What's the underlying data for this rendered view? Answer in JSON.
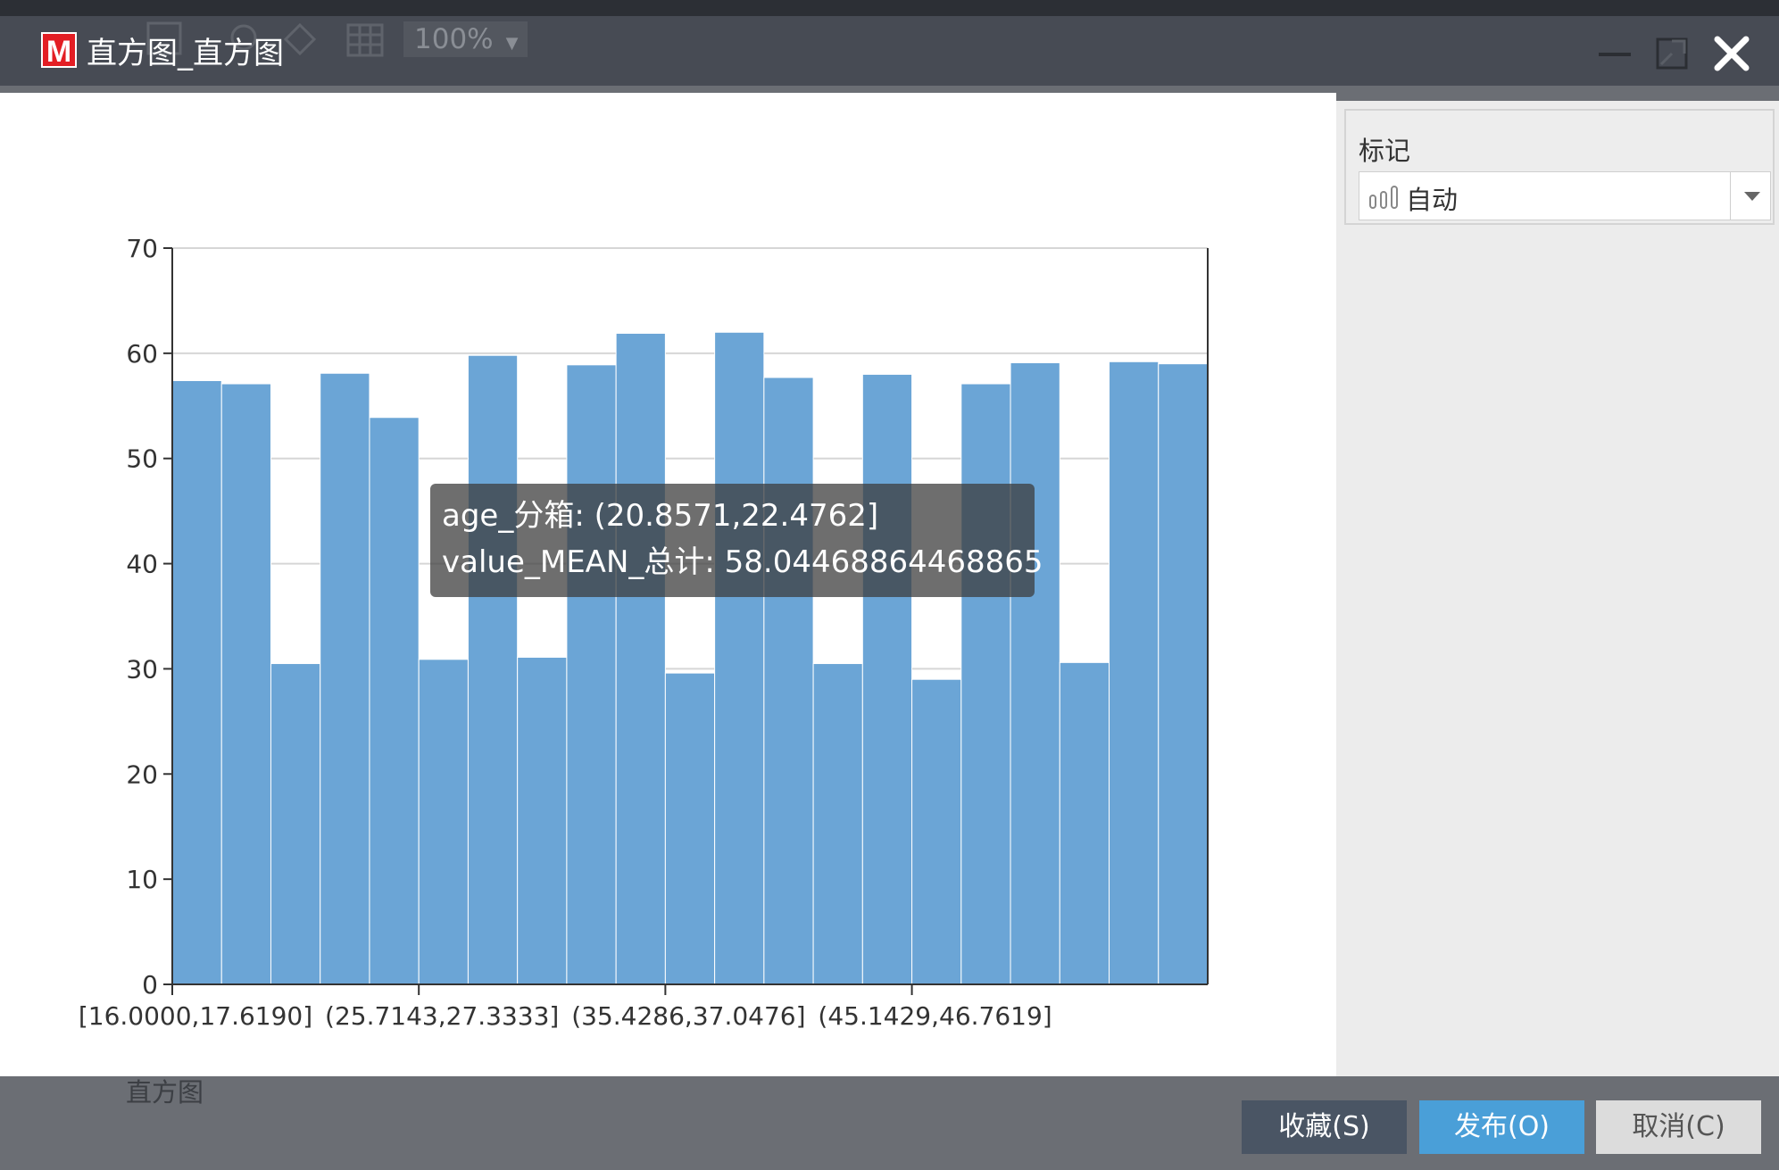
{
  "window": {
    "title": "直方图_直方图",
    "logo_letter": "M",
    "ghost_zoom": "100%"
  },
  "panel": {
    "mark_label": "标记",
    "mark_value": "自动"
  },
  "tooltip": {
    "line1": "age_分箱: (20.8571,22.4762]",
    "line2": "value_MEAN_总计: 58.04468864468865"
  },
  "chart_name": "直方图",
  "buttons": {
    "collect": "收藏(S)",
    "publish": "发布(O)",
    "cancel": "取消(C)"
  },
  "colors": {
    "bar": "#6ba5d6",
    "publish": "#4a9fd8",
    "logo": "#e31e24"
  },
  "chart_data": {
    "type": "bar",
    "ylim": [
      0,
      70
    ],
    "yticks": [
      "0",
      "10",
      "20",
      "30",
      "40",
      "50",
      "60",
      "70"
    ],
    "xtick_labels": [
      "[16.0000,17.6190]",
      "(25.7143,27.3333]",
      "(35.4286,37.0476]",
      "(45.1429,46.7619]"
    ],
    "values": [
      57.4,
      57.1,
      30.5,
      58.1,
      53.9,
      30.9,
      59.8,
      31.1,
      58.9,
      61.9,
      29.6,
      62.0,
      57.7,
      30.5,
      58.0,
      29.0,
      57.1,
      59.1,
      30.6,
      59.2,
      59.0
    ],
    "grid": true
  }
}
